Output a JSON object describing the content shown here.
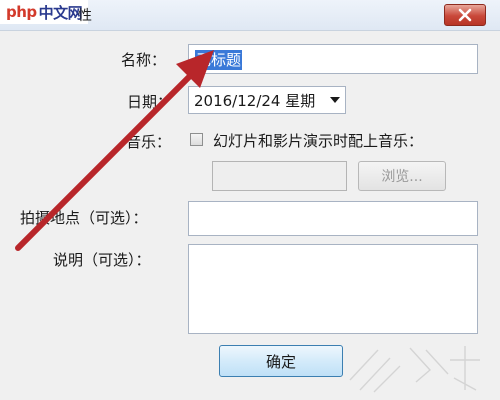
{
  "window": {
    "title": "性",
    "watermark": {
      "latin": "php",
      "cn": "中文网"
    }
  },
  "form": {
    "name_label": "名称：",
    "name_value": "无标题",
    "date_label": "日期：",
    "date_value": "2016/12/24 星期",
    "music_label": "音乐：",
    "music_checkbox_label": "幻灯片和影片演示时配上音乐：",
    "browse_label": "浏览...",
    "location_label": "拍摄地点（可选）：",
    "description_label": "说明（可选）：",
    "ok_label": "确定"
  },
  "colors": {
    "selection": "#3a79d8",
    "arrow": "#b8262a",
    "close_button": "#c9483a"
  },
  "icons": {
    "close": "close-icon",
    "dropdown": "chevron-down-icon"
  }
}
